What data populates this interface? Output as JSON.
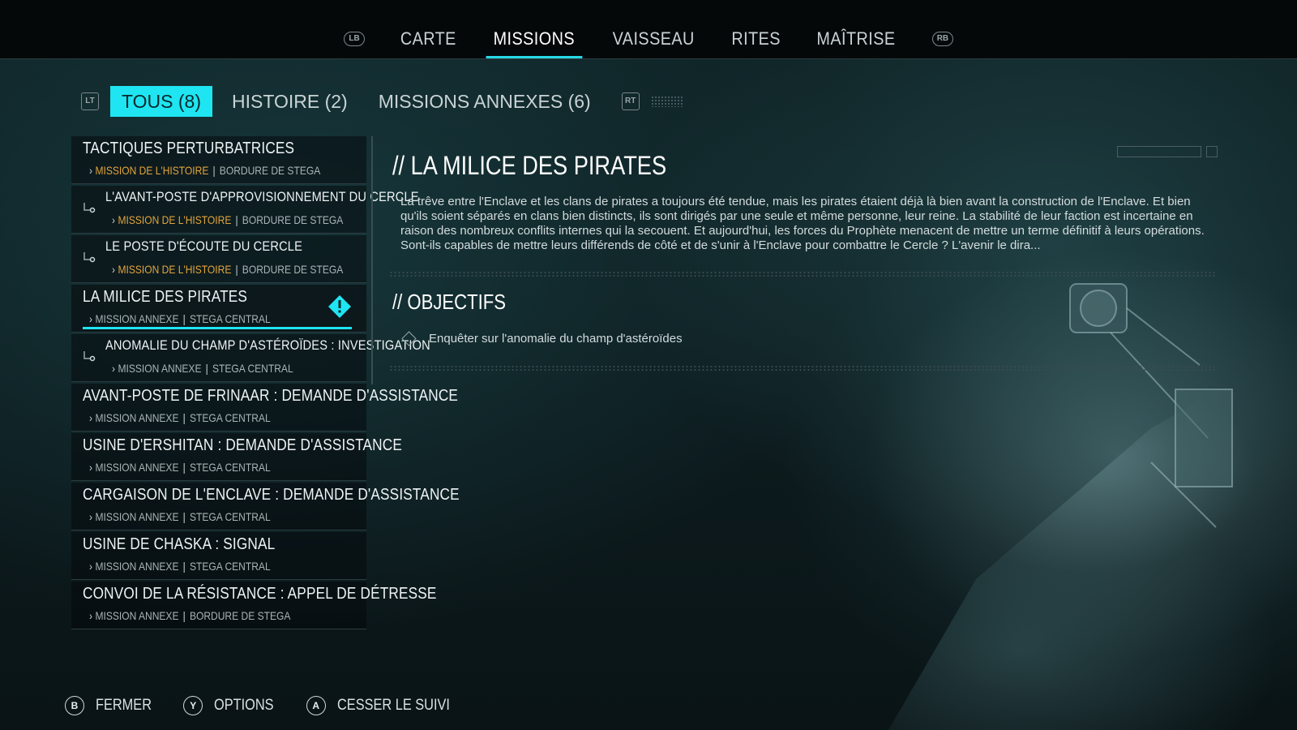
{
  "nav": {
    "left_bumper": "LB",
    "right_bumper": "RB",
    "items": [
      "CARTE",
      "MISSIONS",
      "VAISSEAU",
      "RITES",
      "MAÎTRISE"
    ],
    "active": "MISSIONS"
  },
  "filters": {
    "left_trigger": "LT",
    "right_trigger": "RT",
    "tabs": [
      "TOUS (8)",
      "HISTOIRE (2)",
      "MISSIONS ANNEXES (6)"
    ],
    "active": "TOUS (8)"
  },
  "missions": [
    {
      "title": "TACTIQUES PERTURBATRICES",
      "type": "MISSION DE L'HISTOIRE",
      "location": "BORDURE DE STEGA",
      "story": true,
      "sub": false
    },
    {
      "title": "L'AVANT-POSTE D'APPROVISIONNEMENT DU CERCLE",
      "type": "MISSION DE L'HISTOIRE",
      "location": "BORDURE DE STEGA",
      "story": true,
      "sub": true
    },
    {
      "title": "LE POSTE D'ÉCOUTE DU CERCLE",
      "type": "MISSION DE L'HISTOIRE",
      "location": "BORDURE DE STEGA",
      "story": true,
      "sub": true
    },
    {
      "title": "LA MILICE DES PIRATES",
      "type": "MISSION ANNEXE",
      "location": "STEGA CENTRAL",
      "story": false,
      "sub": false,
      "selected": true
    },
    {
      "title": "ANOMALIE DU CHAMP D'ASTÉROÏDES : INVESTIGATION",
      "type": "MISSION ANNEXE",
      "location": "STEGA CENTRAL",
      "story": false,
      "sub": true
    },
    {
      "title": "AVANT-POSTE DE FRINAAR : DEMANDE D'ASSISTANCE",
      "type": "MISSION ANNEXE",
      "location": "STEGA CENTRAL",
      "story": false,
      "sub": false
    },
    {
      "title": "USINE D'ERSHITAN : DEMANDE D'ASSISTANCE",
      "type": "MISSION ANNEXE",
      "location": "STEGA CENTRAL",
      "story": false,
      "sub": false
    },
    {
      "title": "CARGAISON DE L'ENCLAVE : DEMANDE D'ASSISTANCE",
      "type": "MISSION ANNEXE",
      "location": "STEGA CENTRAL",
      "story": false,
      "sub": false
    },
    {
      "title": "USINE DE CHASKA : SIGNAL",
      "type": "MISSION ANNEXE",
      "location": "STEGA CENTRAL",
      "story": false,
      "sub": false
    },
    {
      "title": "CONVOI DE LA RÉSISTANCE : APPEL DE DÉTRESSE",
      "type": "MISSION ANNEXE",
      "location": "BORDURE DE STEGA",
      "story": false,
      "sub": false
    }
  ],
  "detail": {
    "title": "// LA MILICE DES PIRATES",
    "description": "La trêve entre l'Enclave et les clans de pirates a toujours été tendue, mais les pirates étaient déjà là bien avant la construction de l'Enclave. Et bien qu'ils soient séparés en clans bien distincts, ils sont dirigés par une seule et même personne, leur reine. La stabilité de leur faction est incertaine en raison des nombreux conflits internes qui la secouent. Et aujourd'hui, les forces du Prophète menacent de mettre un terme définitif à leurs opérations. Sont-ils capables de mettre leurs différends de côté et de s'unir à l'Enclave pour combattre le Cercle ? L'avenir le dira...",
    "objectives_title": "// OBJECTIFS",
    "objectives": [
      "Enquêter sur l'anomalie du champ d'astéroïdes"
    ]
  },
  "prompts": [
    {
      "button": "B",
      "label": "FERMER"
    },
    {
      "button": "Y",
      "label": "OPTIONS"
    },
    {
      "button": "A",
      "label": "CESSER LE SUIVI"
    }
  ],
  "colors": {
    "accent": "#1fe5f2",
    "story": "#e3a53c"
  }
}
